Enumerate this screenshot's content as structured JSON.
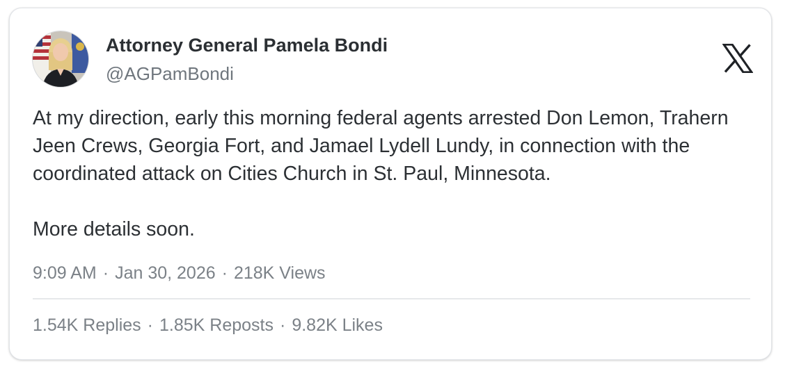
{
  "post": {
    "author_name": "Attorney General Pamela Bondi",
    "handle": "@AGPamBondi",
    "paragraph_1": "At my direction, early this morning federal agents arrested Don Lemon, Trahern Jeen Crews, Georgia Fort, and Jamael Lydell Lundy, in connection with the coordinated attack on Cities Church in St. Paul, Minnesota.",
    "paragraph_2": "More details soon.",
    "time": "9:09 AM",
    "date": "Jan 30, 2026",
    "views": "218K Views",
    "separator": "·",
    "replies": "1.54K Replies",
    "reposts": "1.85K Reposts",
    "likes": "9.82K Likes"
  },
  "icons": {
    "platform": "x-logo-icon",
    "avatar": "avatar-photo"
  },
  "colors": {
    "text_primary": "#2c3034",
    "text_secondary": "#7b8187",
    "border": "#e1e4e8"
  }
}
